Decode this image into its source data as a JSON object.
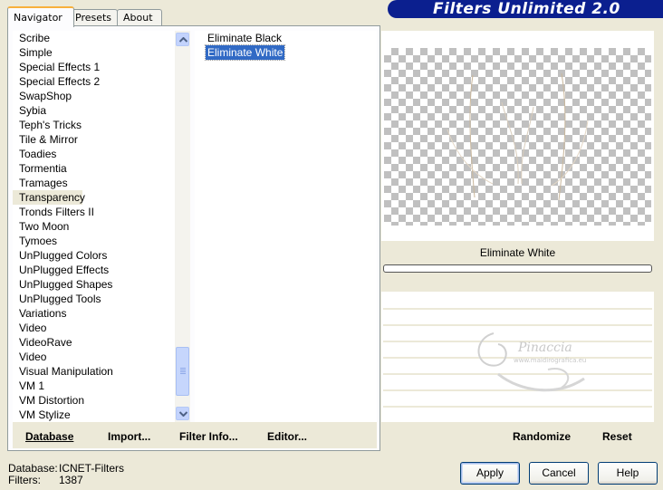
{
  "app": {
    "title": "Filters Unlimited 2.0"
  },
  "tabs": [
    {
      "label": "Navigator",
      "active": true
    },
    {
      "label": "Presets",
      "active": false
    },
    {
      "label": "About",
      "active": false
    }
  ],
  "categories": {
    "items": [
      "Scribe",
      "Simple",
      "Special Effects 1",
      "Special Effects 2",
      "SwapShop",
      "Sybia",
      "Teph's Tricks",
      "Tile & Mirror",
      "Toadies",
      "Tormentia",
      "Tramages",
      "Transparency",
      "Tronds Filters II",
      "Two Moon",
      "Tymoes",
      "UnPlugged Colors",
      "UnPlugged Effects",
      "UnPlugged Shapes",
      "UnPlugged Tools",
      "Variations",
      "Video",
      "VideoRave",
      "Video",
      "Visual Manipulation",
      "VM 1",
      "VM Distortion",
      "VM Stylize"
    ],
    "selected": "Transparency"
  },
  "filters": {
    "items": [
      "Eliminate Black",
      "Eliminate White"
    ],
    "selected": "Eliminate White"
  },
  "left_buttons": {
    "database": "Database",
    "import": "Import...",
    "filter_info": "Filter Info...",
    "editor": "Editor..."
  },
  "preview": {
    "filter_name": "Eliminate White",
    "progress": 0
  },
  "right_buttons": {
    "randomize": "Randomize",
    "reset": "Reset"
  },
  "status": {
    "database_label": "Database:",
    "database_value": "ICNET-Filters",
    "filters_label": "Filters:",
    "filters_value": "1387"
  },
  "dialog_buttons": {
    "apply": "Apply",
    "cancel": "Cancel",
    "help": "Help"
  },
  "watermark": {
    "name": "Pinaccia",
    "url": "www.maidirografica.eu"
  },
  "colors": {
    "banner": "#0b1f8f",
    "selection": "#316ac5",
    "panel_bg": "#ece9d8"
  }
}
